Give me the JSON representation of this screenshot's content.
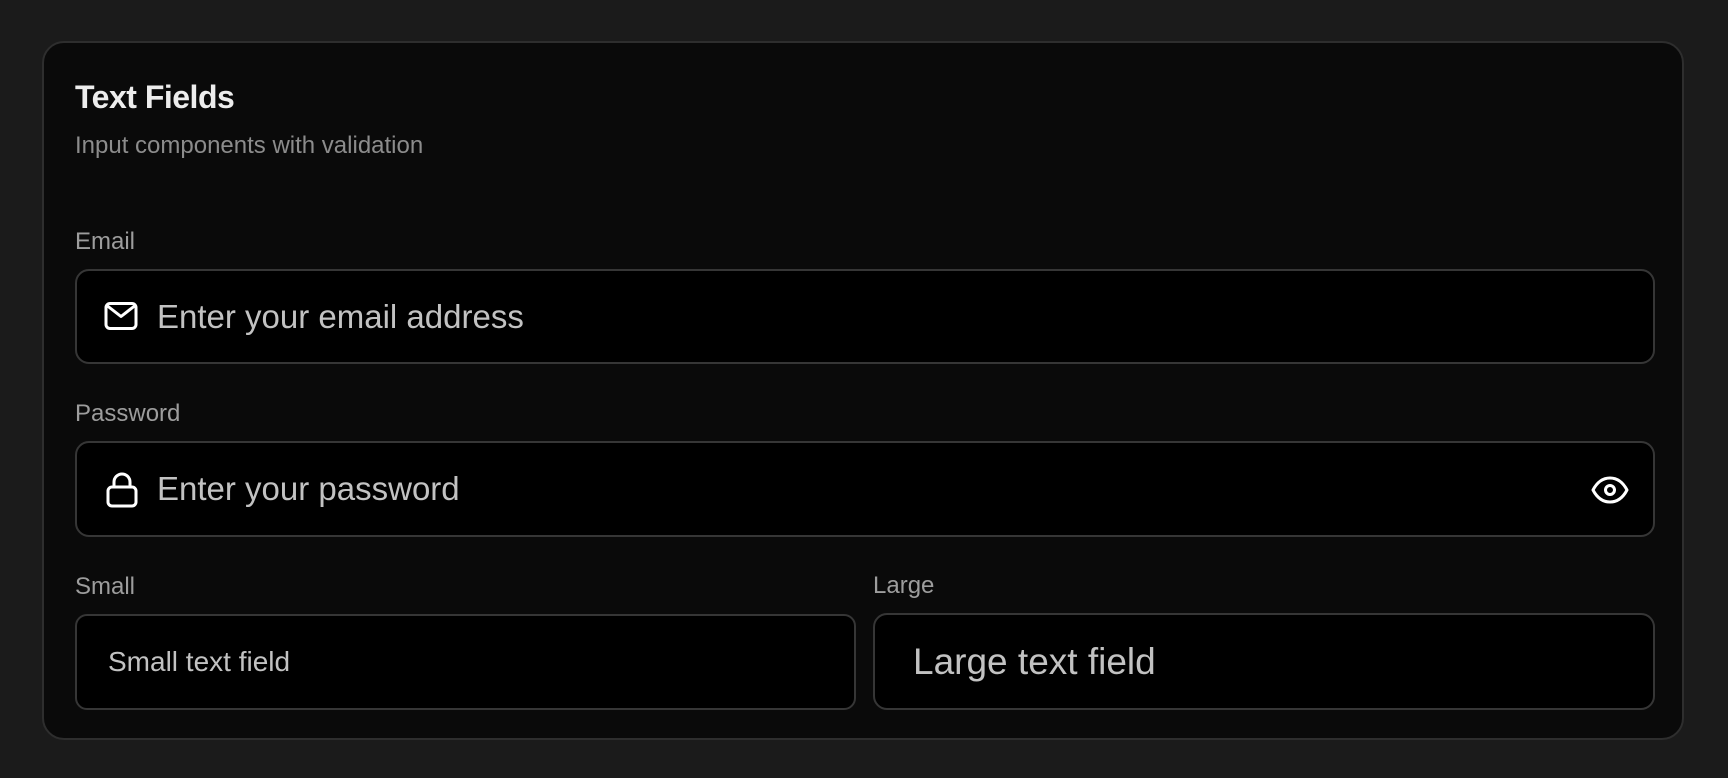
{
  "card": {
    "title": "Text Fields",
    "subtitle": "Input components with validation"
  },
  "fields": {
    "email": {
      "label": "Email",
      "placeholder": "Enter your email address",
      "value": "",
      "icon": "mail-icon"
    },
    "password": {
      "label": "Password",
      "placeholder": "Enter your password",
      "value": "",
      "icon": "lock-icon",
      "toggle_icon": "eye-icon"
    },
    "small": {
      "label": "Small",
      "placeholder": "Small text field",
      "value": ""
    },
    "large": {
      "label": "Large",
      "placeholder": "Large text field",
      "value": ""
    }
  },
  "colors": {
    "page_background": "#1b1b1b",
    "card_background": "#0a0a0a",
    "field_background": "#000000",
    "border": "#363636",
    "title": "#ededed",
    "muted_text": "#8c8c8c"
  }
}
